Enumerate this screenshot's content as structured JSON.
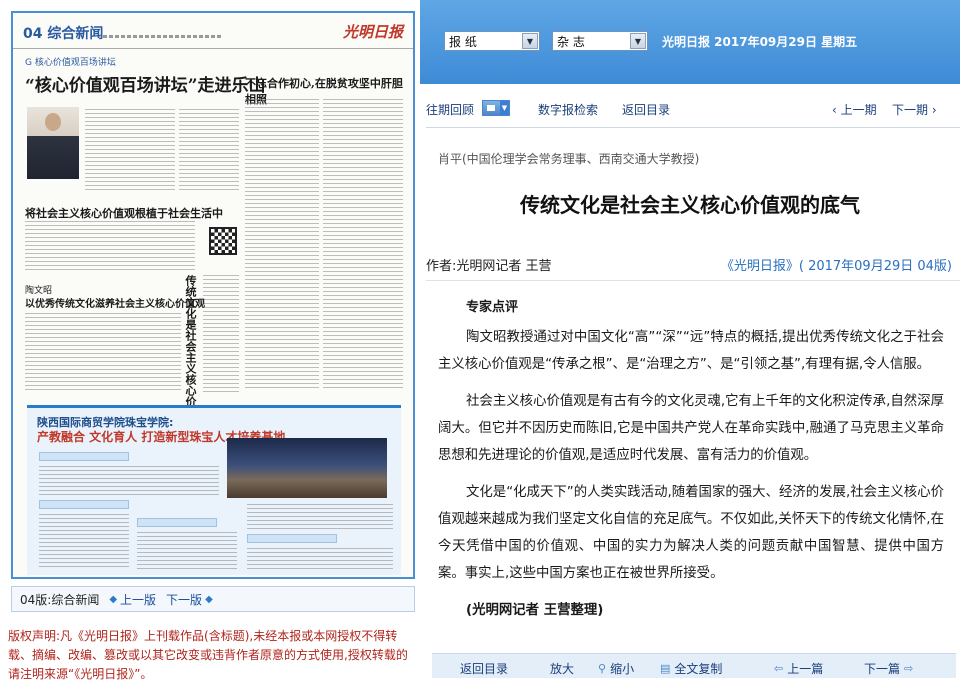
{
  "newspaper": {
    "page_label": "04 综合新闻",
    "logo": "光明日报",
    "column_tag": "G 核心价值观百场讲坛",
    "headline_main": "“核心价值观百场讲坛”走进乐山",
    "headline_right": "不忘合作初心,在脱贫攻坚中肝胆相照",
    "headline_mid": "将社会主义核心价值观根植于社会生活中",
    "author_small": "陶文昭",
    "headline_small": "以优秀传统文化滋养社会主义核心价值观",
    "vertical_headline": "传统文化是社会主义核心价值观的底气",
    "ad_line1": "陕西国际商贸学院珠宝学院:",
    "ad_line2": "产教融合 文化育人 打造新型珠宝人才培养基地"
  },
  "left_nav": {
    "page_name": "04版:综合新闻",
    "prev": "上一版",
    "next": "下一版"
  },
  "copyright": "版权声明:凡《光明日报》上刊载作品(含标题),未经本报或本网授权不得转载、摘编、改编、篡改或以其它改变或违背作者原意的方式使用,授权转载的请注明来源“《光明日报》”。",
  "top_bar": {
    "select_newspaper": "报 纸",
    "select_magazine": "杂 志",
    "date_line": "光明日报 2017年09月29日 星期五"
  },
  "sub_nav": {
    "past_review": "往期回顾",
    "digital_search": "数字报检索",
    "back_catalog": "返回目录",
    "prev_issue": "‹ 上一期",
    "next_issue": "下一期 ›"
  },
  "article": {
    "author_line": "肖平(中国伦理学会常务理事、西南交通大学教授)",
    "title": "传统文化是社会主义核心价值观的底气",
    "byline": "作者:光明网记者 王营",
    "source": "《光明日报》( 2017年09月29日 04版)",
    "section_heading": "专家点评",
    "paragraphs": [
      "陶文昭教授通过对中国文化“高”“深”“远”特点的概括,提出优秀传统文化之于社会主义核心价值观是“传承之根”、是“治理之方”、是“引领之基”,有理有据,令人信服。",
      "社会主义核心价值观是有古有今的文化灵魂,它有上千年的文化积淀传承,自然深厚阔大。但它并不因历史而陈旧,它是中国共产党人在革命实践中,融通了马克思主义革命思想和先进理论的价值观,是适应时代发展、富有活力的价值观。",
      "文化是“化成天下”的人类实践活动,随着国家的强大、经济的发展,社会主义核心价值观越来越成为我们坚定文化自信的充足底气。不仅如此,关怀天下的传统文化情怀,在今天凭借中国的价值观、中国的实力为解决人类的问题贡献中国智慧、提供中国方案。事实上,这些中国方案也正在被世界所接受。"
    ],
    "closing": "(光明网记者 王营整理)"
  },
  "bottom_bar": {
    "back_catalog": "返回目录",
    "zoom_in": "放大",
    "zoom_out": "缩小",
    "copy_all": "全文复制",
    "prev_article": "上一篇",
    "next_article": "下一篇"
  },
  "colors": {
    "top_bar": "#3e8bd6",
    "link_blue": "#2a6fc0",
    "copyright_red": "#b0241c"
  }
}
